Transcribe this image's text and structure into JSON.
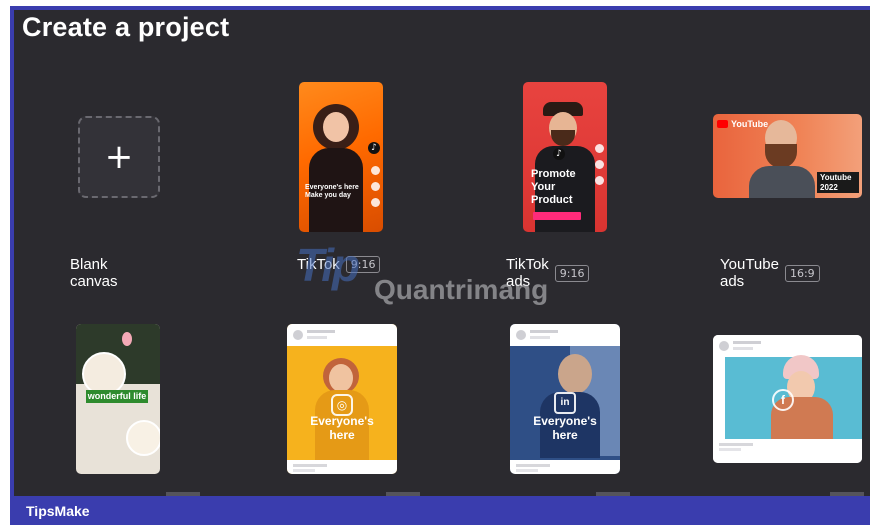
{
  "page": {
    "title": "Create a project"
  },
  "templates": [
    {
      "id": "blank",
      "label": "Blank canvas",
      "ratio": "",
      "icon": "plus-icon"
    },
    {
      "id": "tiktok",
      "label": "TikTok",
      "ratio": "9:16",
      "preview_text": "Everyone's here Make you day"
    },
    {
      "id": "tiktok-ads",
      "label": "TikTok ads",
      "ratio": "9:16",
      "preview_text": "Promote Your Product"
    },
    {
      "id": "youtube-ads",
      "label": "YouTube ads",
      "ratio": "16:9",
      "preview_brand": "YouTube",
      "preview_badge": "Youtube 2022"
    }
  ],
  "second_row": [
    {
      "id": "food-story",
      "preview_text": "wonderful life",
      "icon": "instagram-icon"
    },
    {
      "id": "instagram-post",
      "preview_text": "Everyone's here",
      "icon": "instagram-icon"
    },
    {
      "id": "linkedin-post",
      "preview_text": "Everyone's here",
      "icon": "linkedin-icon"
    },
    {
      "id": "facebook-post",
      "preview_text": "",
      "icon": "facebook-icon"
    }
  ],
  "watermark": {
    "mark": "Tip",
    "text": "Quantrimang"
  },
  "footer": {
    "brand": "TipsMake"
  },
  "colors": {
    "panel_bg": "#2b2a2f",
    "frame_accent": "#3a3dae",
    "label_text": "#ffffff"
  }
}
